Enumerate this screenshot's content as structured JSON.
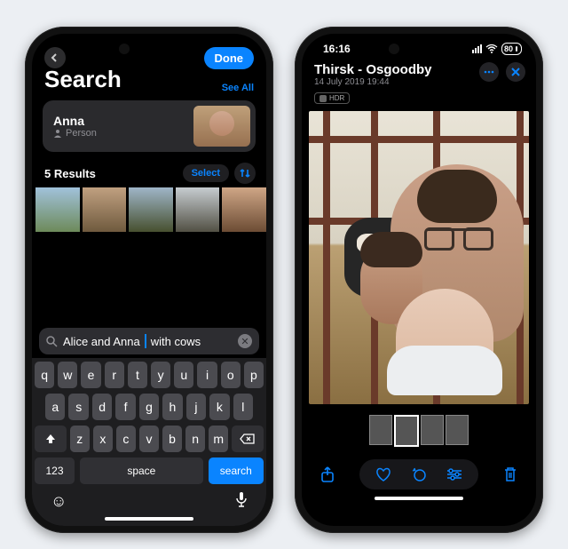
{
  "phone1": {
    "topbar": {
      "done": "Done"
    },
    "header": {
      "title": "Search",
      "see_all": "See All"
    },
    "person": {
      "name": "Anna",
      "type": "Person"
    },
    "results": {
      "count_label": "5 Results",
      "select": "Select"
    },
    "search": {
      "query_highlighted": "Alice and Anna ",
      "query_rest": "with cows"
    },
    "keyboard": {
      "row1": [
        "q",
        "w",
        "e",
        "r",
        "t",
        "y",
        "u",
        "i",
        "o",
        "p"
      ],
      "row2": [
        "a",
        "s",
        "d",
        "f",
        "g",
        "h",
        "j",
        "k",
        "l"
      ],
      "row3": [
        "z",
        "x",
        "c",
        "v",
        "b",
        "n",
        "m"
      ],
      "num": "123",
      "space": "space",
      "search": "search"
    }
  },
  "phone2": {
    "status": {
      "time": "16:16",
      "battery": "80"
    },
    "header": {
      "title": "Thirsk - Osgoodby",
      "subtitle": "14 July 2019 19:44",
      "badge": "HDR"
    }
  }
}
